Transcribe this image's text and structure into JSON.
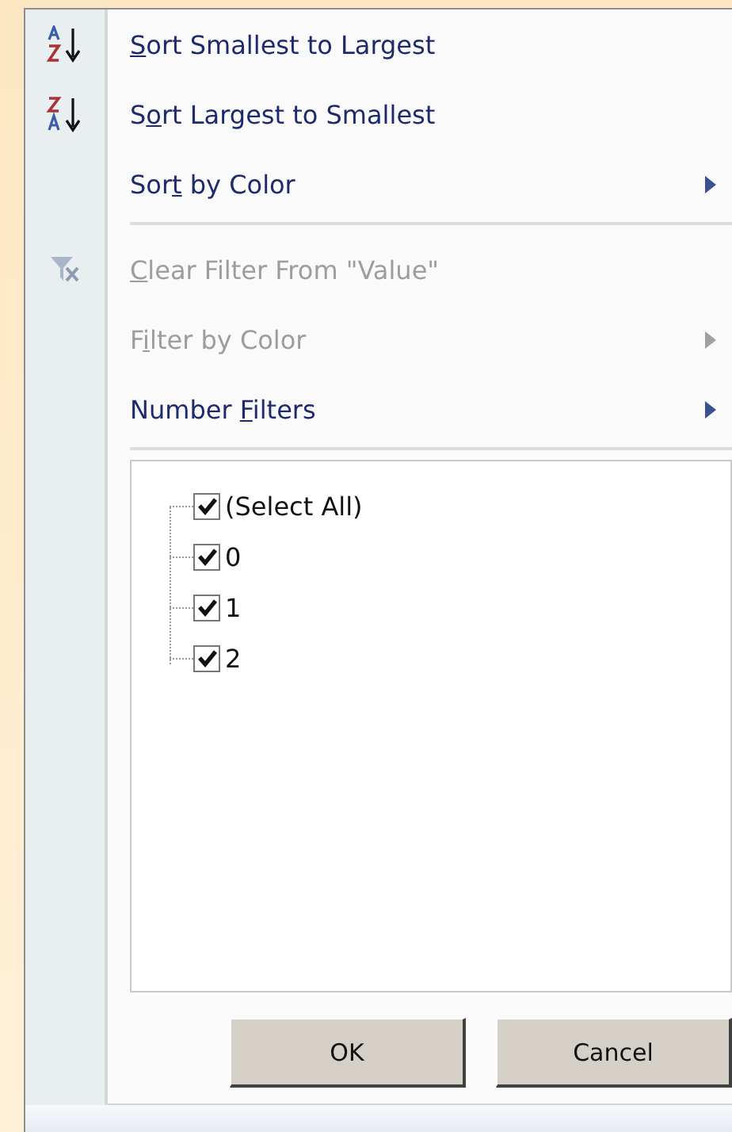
{
  "menu": {
    "items": [
      {
        "kind": "ascending",
        "access_key": "S",
        "after": "ort Smallest to Largest",
        "disabled": false
      },
      {
        "kind": "descending",
        "before": "S",
        "access_key": "o",
        "after": "rt Largest to Smallest",
        "disabled": false
      },
      {
        "kind": "submenu",
        "before": "Sor",
        "access_key": "t",
        "after": " by Color",
        "disabled": false
      },
      {
        "kind": "separator"
      },
      {
        "kind": "clear",
        "access_key": "C",
        "after": "lear Filter From \"Value\"",
        "disabled": true
      },
      {
        "kind": "submenu",
        "before": "F",
        "access_key": "i",
        "after": "lter by Color",
        "disabled": true
      },
      {
        "kind": "submenu",
        "before": "Number ",
        "access_key": "F",
        "after": "ilters",
        "disabled": false
      },
      {
        "kind": "separator"
      }
    ]
  },
  "values": [
    {
      "label": "(Select All)",
      "checked": true
    },
    {
      "label": "0",
      "checked": true
    },
    {
      "label": "1",
      "checked": true
    },
    {
      "label": "2",
      "checked": true
    }
  ],
  "buttons": [
    "OK",
    "Cancel"
  ]
}
